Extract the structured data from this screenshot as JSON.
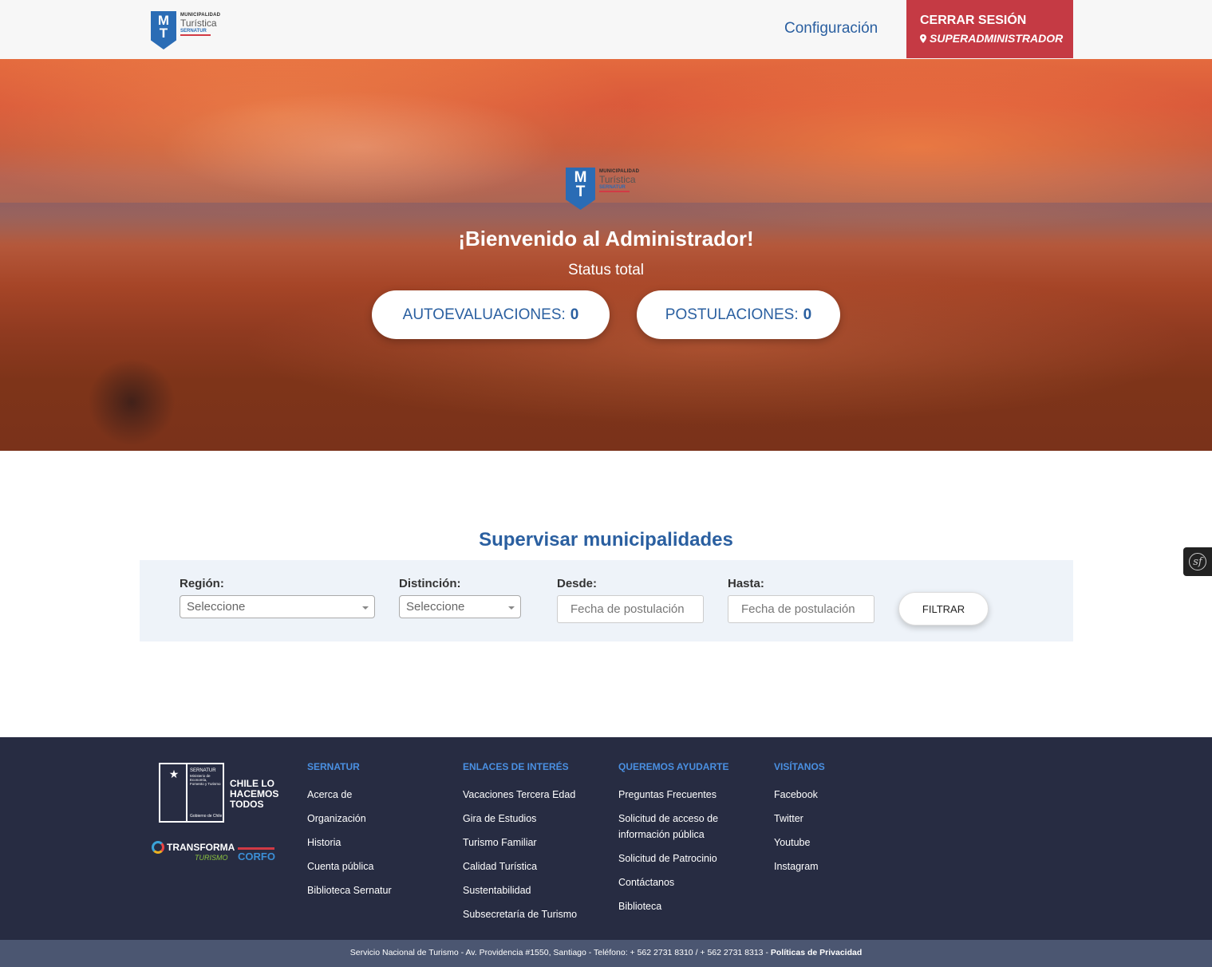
{
  "header": {
    "logo": {
      "line1": "MUNICIPALIDAD",
      "line2": "Turística",
      "line3": "SERNATUR",
      "shield_m": "M",
      "shield_t": "T"
    },
    "config_link": "Configuración",
    "logout_label": "CERRAR SESIÓN",
    "user_label": "SUPERADMINISTRADOR"
  },
  "hero": {
    "logo": {
      "line1": "MUNICIPALIDAD",
      "line2": "Turística",
      "line3": "SERNATUR",
      "shield_m": "M",
      "shield_t": "T"
    },
    "title": "¡Bienvenido al Administrador!",
    "subtitle": "Status total",
    "autoevaluaciones_label": "AUTOEVALUACIONES:",
    "autoevaluaciones_value": "0",
    "postulaciones_label": "POSTULACIONES:",
    "postulaciones_value": "0"
  },
  "supervise": {
    "title": "Supervisar municipalidades",
    "region_label": "Región:",
    "region_value": "Seleccione",
    "distincion_label": "Distinción:",
    "distincion_value": "Seleccione",
    "desde_label": "Desde:",
    "desde_placeholder": "Fecha de postulación",
    "hasta_label": "Hasta:",
    "hasta_placeholder": "Fecha de postulación",
    "filter_button": "FILTRAR"
  },
  "footer": {
    "gob": {
      "line1": "SERNATUR",
      "line2": "Ministerio de Economía, Fomento y Turismo",
      "line3": "Gobierno de Chile"
    },
    "chile_text": "CHILE LO HACEMOS TODOS",
    "transforma": "TRANSFORMA",
    "turismo": "TURISMO",
    "corfo": "CORFO",
    "columns": [
      {
        "head": "SERNATUR",
        "links": [
          "Acerca de",
          "Organización",
          "Historia",
          "Cuenta pública",
          "Biblioteca Sernatur"
        ]
      },
      {
        "head": "ENLACES DE INTERÉS",
        "links": [
          "Vacaciones Tercera Edad",
          "Gira de Estudios",
          "Turismo Familiar",
          "Calidad Turística",
          "Sustentabilidad",
          "Subsecretaría de Turismo"
        ]
      },
      {
        "head": "QUEREMOS AYUDARTE",
        "links": [
          "Preguntas Frecuentes",
          "Solicitud de acceso de información pública",
          "Solicitud de Patrocinio",
          "Contáctanos",
          "Biblioteca"
        ]
      },
      {
        "head": "VISÍTANOS",
        "links": [
          "Facebook",
          "Twitter",
          "Youtube",
          "Instagram"
        ]
      }
    ],
    "bottom_text": "Servicio Nacional de Turismo - Av. Providencia #1550, Santiago - Teléfono: + 562 2731 8310 / + 562 2731 8313 - ",
    "privacy_link": "Políticas de Privacidad"
  },
  "debug_toolbar_glyph": "sf",
  "colors": {
    "brand_blue": "#2a5fa0",
    "logout_red": "#c53a44",
    "footer_bg": "#272c42",
    "footer_head": "#4a90e2"
  }
}
